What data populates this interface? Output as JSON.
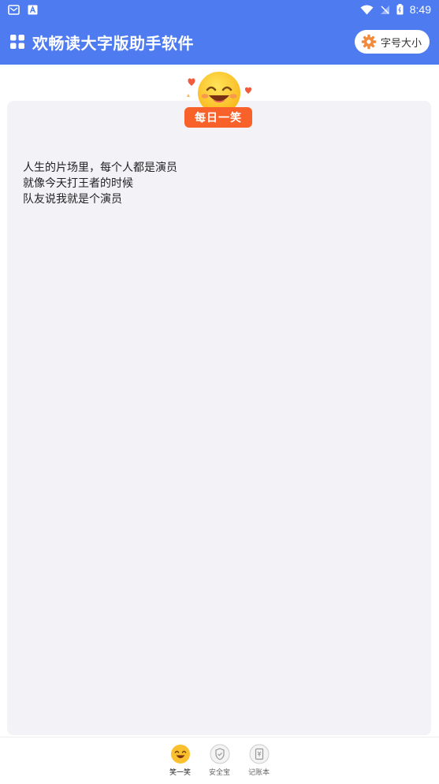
{
  "status_bar": {
    "time": "8:49"
  },
  "app_bar": {
    "title": "欢畅读大字版助手软件",
    "font_size_button": "字号大小"
  },
  "badge": {
    "label": "每日一笑"
  },
  "joke": {
    "lines": [
      "人生的片场里，每个人都是演员",
      "就像今天打王者的时候",
      "队友说我就是个演员"
    ]
  },
  "bottom_nav": {
    "items": [
      {
        "label": "笑一笑",
        "icon": "smile-face-icon",
        "active": true
      },
      {
        "label": "安全宝",
        "icon": "shield-icon",
        "active": false
      },
      {
        "label": "记账本",
        "icon": "notebook-icon",
        "active": false
      }
    ]
  },
  "colors": {
    "brand": "#4e7bf0",
    "badge": "#f8622a",
    "card": "#f3f3f7",
    "icon_orange": "#f08a3c"
  }
}
